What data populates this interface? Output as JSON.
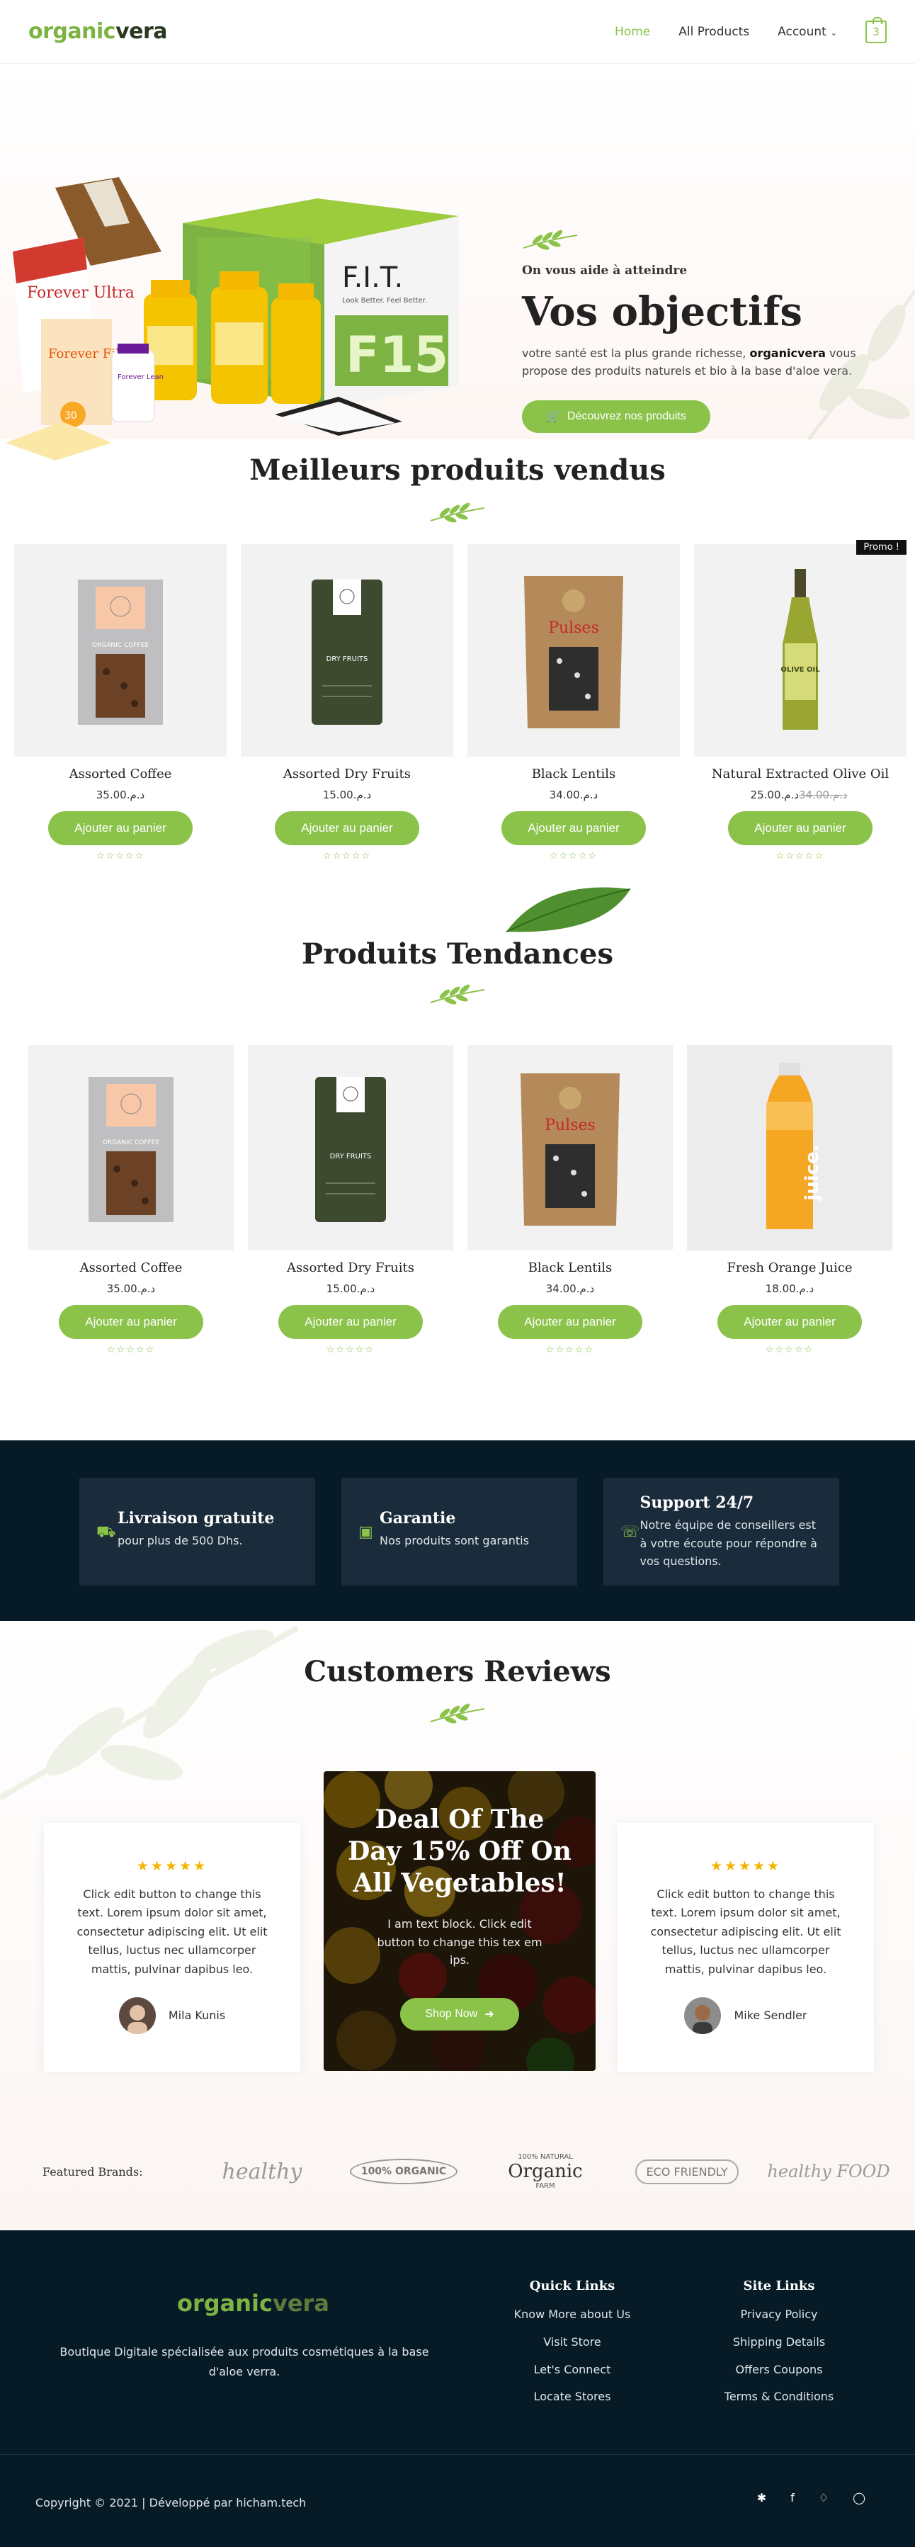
{
  "header": {
    "logo_part1": "organic",
    "logo_part2": "vera",
    "nav": {
      "home": "Home",
      "all_products": "All Products",
      "account": "Account"
    },
    "cart_count": "3"
  },
  "hero": {
    "subtitle": "On vous aide à atteindre",
    "title": "Vos objectifs",
    "desc_before": "votre santé est la plus grande richesse, ",
    "desc_brand": "organicvera",
    "desc_after": " vous propose des produits naturels et bio à la base d'aloe vera.",
    "button": "Découvrez nos produits",
    "product_labels": {
      "forever_ultra": "Forever Ultra",
      "forever_fiber": "Forever Fiber",
      "forever_lean": "Forever Lean",
      "fit_title": "F.I.T.",
      "fit_sub": "Look Better. Feel Better.",
      "f15": "F15",
      "number": "30"
    }
  },
  "bestsellers": {
    "title": "Meilleurs produits vendus",
    "promo_badge": "Promo !",
    "add_label": "Ajouter au panier",
    "products": [
      {
        "name": "Assorted Coffee",
        "price": "35.00",
        "currency": "د.م."
      },
      {
        "name": "Assorted Dry Fruits",
        "price": "15.00",
        "currency": "د.م."
      },
      {
        "name": "Black Lentils",
        "price": "34.00",
        "currency": "د.م."
      },
      {
        "name": "Natural Extracted Olive Oil",
        "old_price": "34.00",
        "price": "25.00",
        "currency": "د.م."
      }
    ]
  },
  "trending": {
    "title": "Produits Tendances",
    "add_label": "Ajouter au panier",
    "products": [
      {
        "name": "Assorted Coffee",
        "price": "35.00",
        "currency": "د.م."
      },
      {
        "name": "Assorted Dry Fruits",
        "price": "15.00",
        "currency": "د.م."
      },
      {
        "name": "Black Lentils",
        "price": "34.00",
        "currency": "د.م."
      },
      {
        "name": "Fresh Orange Juice",
        "price": "18.00",
        "currency": "د.م."
      }
    ]
  },
  "package_labels": {
    "coffee": "ORGANIC COFFEE",
    "dry_fruits": "DRY FRUITS",
    "pulses": "Pulses",
    "olive": "OLIVE OIL",
    "juice": "juice."
  },
  "features": [
    {
      "title": "Livraison gratuite",
      "desc": "pour plus de 500 Dhs.",
      "icon": "truck-icon"
    },
    {
      "title": "Garantie",
      "desc": "Nos produits sont garantis",
      "icon": "money-icon"
    },
    {
      "title": "Support 24/7",
      "desc": "Notre équipe de conseillers est à votre écoute pour répondre à vos questions.",
      "icon": "headset-icon"
    }
  ],
  "reviews": {
    "title": "Customers Reviews",
    "items": [
      {
        "text": "Click edit button to change this text. Lorem ipsum dolor sit amet, consectetur adipiscing elit. Ut elit tellus, luctus nec ullamcorper mattis, pulvinar dapibus leo.",
        "author": "Mila Kunis",
        "stars": "★★★★★"
      },
      {
        "text": "Click edit button to change this text. Lorem ipsum dolor sit amet, consectetur adipiscing elit. Ut elit tellus, luctus nec ullamcorper mattis, pulvinar dapibus leo.",
        "author": "Mike Sendler",
        "stars": "★★★★★"
      }
    ],
    "deal": {
      "title": "Deal Of The Day 15% Off On All Vegetables!",
      "text": "I am text block. Click edit button to change this tex em ips.",
      "button": "Shop Now"
    }
  },
  "brands": {
    "label": "Featured Brands:",
    "logos": [
      "healthy",
      "100% ORGANIC",
      "Organic",
      "ECO FRIENDLY",
      "healthy FOOD"
    ],
    "logo_small": {
      "nature": "100% NATURAL",
      "farm": "FARM",
      "food": "FOOD"
    }
  },
  "footer": {
    "logo_part1": "organic",
    "logo_part2": "vera",
    "desc": "Boutique Digitale spécialisée aux produits cosmétiques à la base d'aloe verra.",
    "quick_links_title": "Quick Links",
    "quick_links": [
      "Know More about Us",
      "Visit Store",
      "Let's Connect",
      "Locate Stores"
    ],
    "site_links_title": "Site Links",
    "site_links": [
      "Privacy Policy",
      "Shipping Details",
      "Offers Coupons",
      "Terms & Conditions"
    ],
    "copyright": "Copyright © 2021 | Développé par hicham.tech"
  },
  "colors": {
    "accent": "#8bc34a",
    "dark": "#071b27",
    "feature_box": "#1a2c3b",
    "star": "#f5b301"
  }
}
